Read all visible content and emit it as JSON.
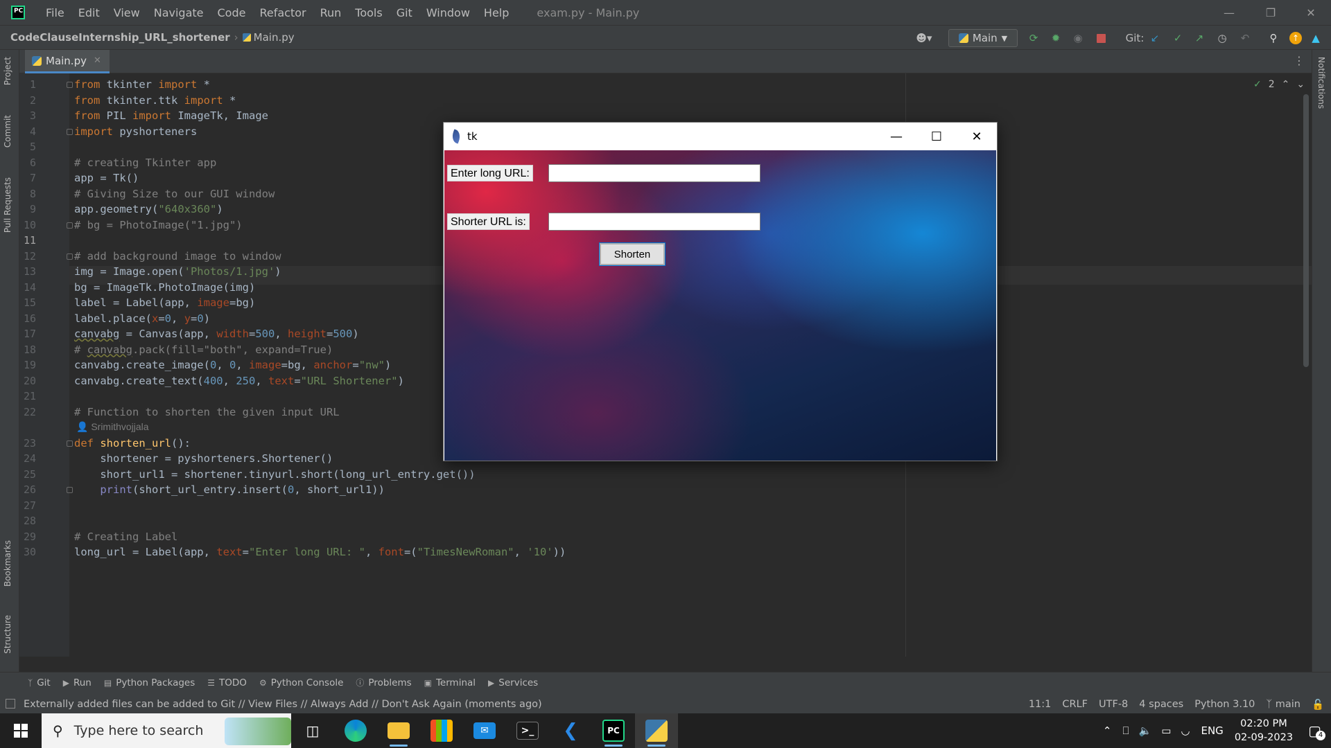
{
  "ide": {
    "menu": [
      "File",
      "Edit",
      "View",
      "Navigate",
      "Code",
      "Refactor",
      "Run",
      "Tools",
      "Git",
      "Window",
      "Help"
    ],
    "window_title": "exam.py - Main.py",
    "breadcrumb": {
      "project": "CodeClauseInternship_URL_shortener",
      "file": "Main.py"
    },
    "run_config": "Main",
    "git_label": "Git:",
    "tab": "Main.py",
    "inspections_count": "2",
    "left_tabs": [
      "Project",
      "Commit",
      "Pull Requests",
      "Bookmarks",
      "Structure"
    ],
    "right_tabs": [
      "Notifications"
    ]
  },
  "editor": {
    "author_hint": "Srimithvojjala",
    "current_line": "11",
    "lines": [
      {
        "n": "1",
        "html": "<span class=\"kw\">from</span> tkinter <span class=\"kw\">import</span> *"
      },
      {
        "n": "2",
        "html": "<span class=\"kw\">from</span> tkinter.ttk <span class=\"kw\">import</span> *"
      },
      {
        "n": "3",
        "html": "<span class=\"kw\">from</span> PIL <span class=\"kw\">import</span> ImageTk, Image"
      },
      {
        "n": "4",
        "html": "<span class=\"kw\">import</span> pyshorteners"
      },
      {
        "n": "5",
        "html": ""
      },
      {
        "n": "6",
        "html": "<span class=\"cm\"># creating Tkinter app</span>"
      },
      {
        "n": "7",
        "html": "app = Tk()"
      },
      {
        "n": "8",
        "html": "<span class=\"cm\"># Giving Size to our GUI window</span>"
      },
      {
        "n": "9",
        "html": "app.geometry(<span class=\"st\">\"640x360\"</span>)"
      },
      {
        "n": "10",
        "html": "<span class=\"cm\"># bg = PhotoImage(\"1.jpg\")</span>"
      },
      {
        "n": "11",
        "html": ""
      },
      {
        "n": "12",
        "html": "<span class=\"cm\"># add background image to window</span>"
      },
      {
        "n": "13",
        "html": "img = Image.open(<span class=\"st\">'Photos/1.jpg'</span>)"
      },
      {
        "n": "14",
        "html": "bg = ImageTk.PhotoImage(img)"
      },
      {
        "n": "15",
        "html": "label = Label(app, <span class=\"pn\">image</span>=bg)"
      },
      {
        "n": "16",
        "html": "label.place(<span class=\"pn\">x</span>=<span class=\"nm\">0</span>, <span class=\"pn\">y</span>=<span class=\"nm\">0</span>)"
      },
      {
        "n": "17",
        "html": "<span class=\"ul\">canvabg</span> = Canvas(app, <span class=\"pn\">width</span>=<span class=\"nm\">500</span>, <span class=\"pn\">height</span>=<span class=\"nm\">500</span>)"
      },
      {
        "n": "18",
        "html": "<span class=\"cm\"># <span class=\"ul\">canvabg</span>.pack(fill=\"both\", expand=True)</span>"
      },
      {
        "n": "19",
        "html": "canvabg.create_image(<span class=\"nm\">0</span>, <span class=\"nm\">0</span>, <span class=\"pn\">image</span>=bg, <span class=\"pn\">anchor</span>=<span class=\"st\">\"nw\"</span>)"
      },
      {
        "n": "20",
        "html": "canvabg.create_text(<span class=\"nm\">400</span>, <span class=\"nm\">250</span>, <span class=\"pn\">text</span>=<span class=\"st\">\"URL Shortener\"</span>)"
      },
      {
        "n": "21",
        "html": ""
      },
      {
        "n": "22",
        "html": "<span class=\"cm\"># Function to shorten the given input URL</span>"
      },
      {
        "n": "23",
        "html": "<span class=\"kw\">def</span> <span class=\"fn\">shorten_url</span>():"
      },
      {
        "n": "24",
        "html": "    shortener = pyshorteners.Shortener()"
      },
      {
        "n": "25",
        "html": "    short_url1 = shortener.tinyurl.short(long_url_entry.get())"
      },
      {
        "n": "26",
        "html": "    <span class=\"bi\">print</span>(short_url_entry.insert(<span class=\"nm\">0</span>, short_url1))"
      },
      {
        "n": "27",
        "html": ""
      },
      {
        "n": "28",
        "html": ""
      },
      {
        "n": "29",
        "html": "<span class=\"cm\"># Creating Label</span>"
      },
      {
        "n": "30",
        "html": "long_url = Label(app, <span class=\"pn\">text</span>=<span class=\"st\">\"Enter long URL: \"</span>, <span class=\"pn\">font</span>=(<span class=\"st\">\"TimesNewRoman\"</span>, <span class=\"st\">'10'</span>))"
      }
    ]
  },
  "tk": {
    "title": "tk",
    "long_label": "Enter long URL:",
    "long_value": "",
    "short_label": "Shorter URL is:",
    "short_value": "",
    "button": "Shorten"
  },
  "bottom_tools": [
    "Git",
    "Run",
    "Python Packages",
    "TODO",
    "Python Console",
    "Problems",
    "Terminal",
    "Services"
  ],
  "status": {
    "message": "Externally added files can be added to Git // View Files // Always Add // Don't Ask Again (moments ago)",
    "position": "11:1",
    "line_sep": "CRLF",
    "encoding": "UTF-8",
    "indent": "4 spaces",
    "interpreter": "Python 3.10",
    "branch": "main"
  },
  "taskbar": {
    "search_placeholder": "Type here to search",
    "lang": "ENG",
    "time": "02:20 PM",
    "date": "02-09-2023",
    "notifications": "4"
  }
}
